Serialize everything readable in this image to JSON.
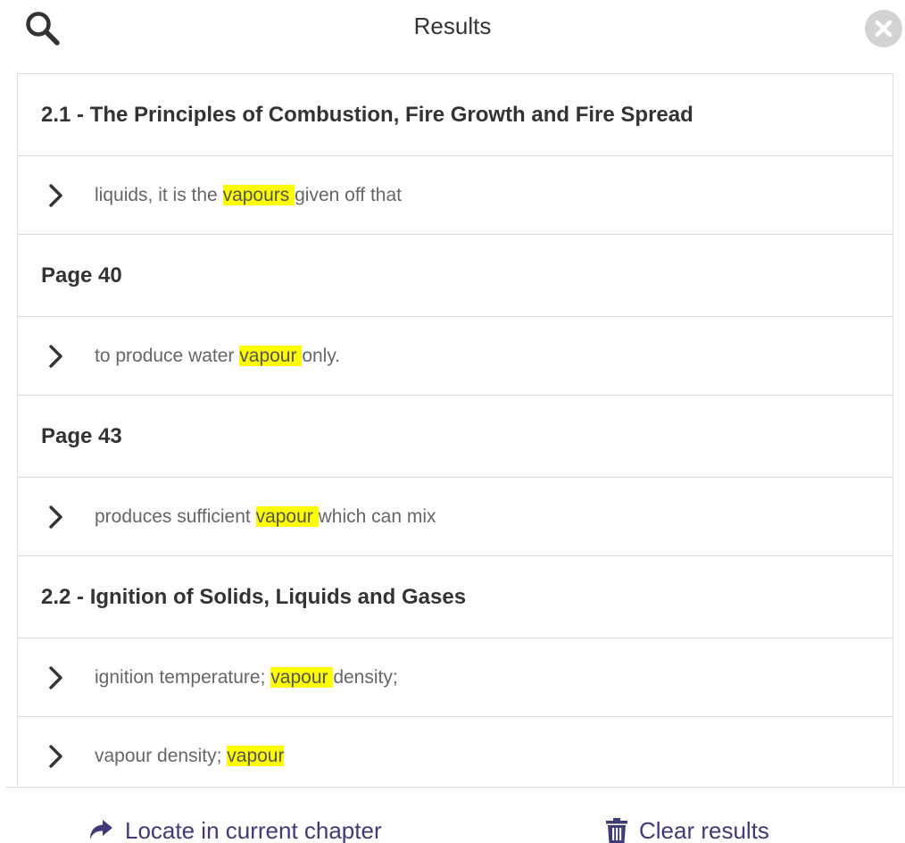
{
  "header": {
    "title": "Results",
    "search_icon": "search-icon",
    "close_icon": "close-icon"
  },
  "results": [
    {
      "heading": "2.1 - The Principles of Combustion, Fire Growth and Fire Spread",
      "items": [
        {
          "before": "liquids, it is the ",
          "match": "vapours ",
          "after": "given off that"
        }
      ]
    },
    {
      "heading": "Page 40",
      "items": [
        {
          "before": "to produce water ",
          "match": "vapour ",
          "after": "only."
        }
      ]
    },
    {
      "heading": "Page 43",
      "items": [
        {
          "before": "produces sufficient ",
          "match": "vapour ",
          "after": "which can mix"
        }
      ]
    },
    {
      "heading": "2.2 - Ignition of Solids, Liquids and Gases",
      "items": [
        {
          "before": "ignition temperature; ",
          "match": "vapour ",
          "after": "density;"
        },
        {
          "before": "vapour density; ",
          "match": "vapour",
          "after": ""
        }
      ]
    }
  ],
  "footer": {
    "locate_label": "Locate in current chapter",
    "clear_label": "Clear results",
    "locate_icon": "share-arrow-icon",
    "clear_icon": "trash-icon"
  },
  "colors": {
    "highlight": "#ffff00",
    "accent": "#3f3b73",
    "close_bg": "#d3d3d3",
    "divider": "#dcdcdc"
  }
}
